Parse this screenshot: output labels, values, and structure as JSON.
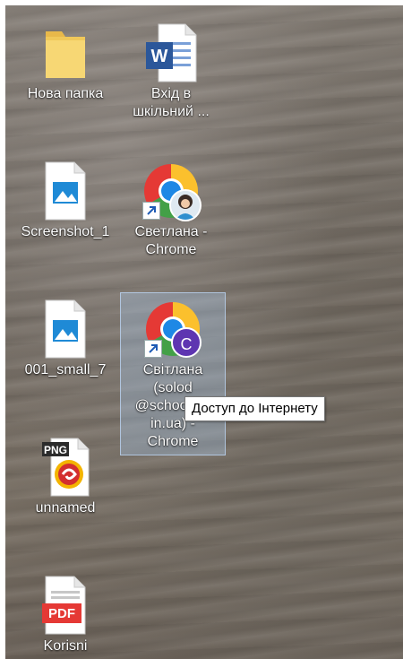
{
  "desktop": {
    "icons": [
      {
        "label": "Нова папка",
        "icon": "folder-icon"
      },
      {
        "label": "Вхід в шкільний ...",
        "icon": "word-document-icon"
      },
      {
        "label": "Screenshot_1",
        "icon": "image-file-icon"
      },
      {
        "label": "Светлана - Chrome",
        "icon": "chrome-profile-icon"
      },
      {
        "label": "001_small_7",
        "icon": "image-file-icon"
      },
      {
        "label": "Світлана (solod @school54.in.ua) - Chrome",
        "icon": "chrome-profile-icon",
        "selected": true,
        "profile_initial": "C"
      },
      {
        "label": "unnamed",
        "icon": "png-file-icon"
      },
      {
        "label": "Korisni",
        "icon": "pdf-file-icon"
      }
    ]
  },
  "tooltip": {
    "text": "Доступ до Інтернету"
  },
  "icon_badges": {
    "png": "PNG",
    "pdf": "PDF",
    "word": "W"
  },
  "colors": {
    "selection": "#aac8eb",
    "profile_badge": "#5e35b1",
    "pdf_red": "#e53935",
    "word_blue": "#2b579a"
  }
}
